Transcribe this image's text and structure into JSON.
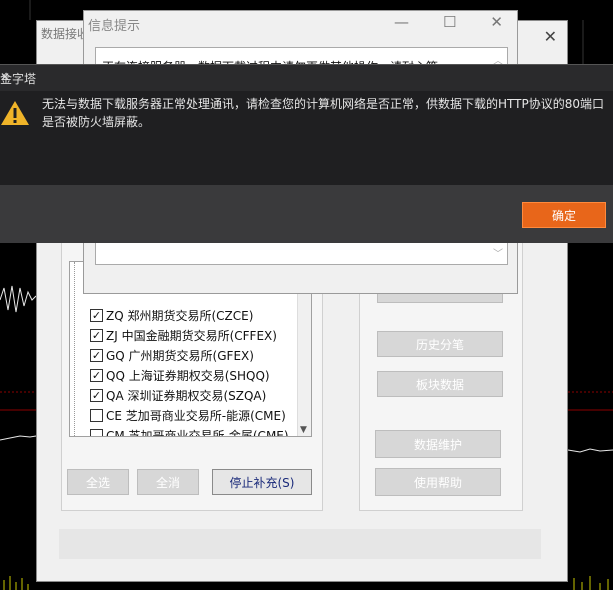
{
  "main_window": {
    "title": "数据接收",
    "close_glyph": "✕"
  },
  "info_dialog": {
    "title": "信息提示",
    "minimize_glyph": "—",
    "maximize_glyph": "☐",
    "close_glyph": "✕",
    "text": "正在连接服务器，数据下载过程中请勿再做其他操作，请耐心等..."
  },
  "alert": {
    "title": "金字塔",
    "close_glyph": "✕",
    "message": "无法与数据下载服务器正常处理通讯，请检查您的计算机网络是否正常，供数据下载的HTTP协议的80端口是否被防火墙屏蔽。",
    "ok_label": "确定",
    "accent_color": "#e8661a"
  },
  "exchanges": [
    {
      "label": "ZQ 郑州期货交易所(CZCE)",
      "checked": true
    },
    {
      "label": "ZJ 中国金融期货交易所(CFFEX)",
      "checked": true
    },
    {
      "label": "GQ 广州期货交易所(GFEX)",
      "checked": true
    },
    {
      "label": "QQ 上海证券期权交易(SHQQ)",
      "checked": true
    },
    {
      "label": "QA 深圳证券期权交易(SZQA)",
      "checked": true
    },
    {
      "label": "CE 芝加哥商业交易所-能源(CME)",
      "checked": false
    },
    {
      "label": "CM 芝加哥商业交易所-金属(CME)",
      "checked": false
    }
  ],
  "left_buttons": {
    "select_all": "全选",
    "deselect_all": "全消",
    "stop": "停止补充(S)"
  },
  "right_buttons": {
    "history_ticks": "历史分笔",
    "sector_data": "板块数据",
    "data_maintenance": "数据维护",
    "help": "使用帮助"
  }
}
